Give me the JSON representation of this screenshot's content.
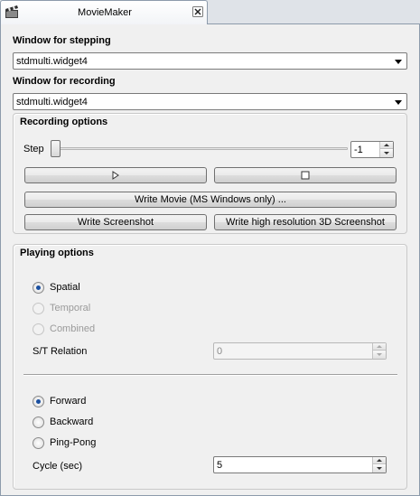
{
  "tab": {
    "title": "MovieMaker",
    "icon": "film-clapper-icon",
    "close_icon": "close-icon"
  },
  "stepping": {
    "label": "Window for stepping",
    "value": "stdmulti.widget4"
  },
  "recording": {
    "label": "Window for recording",
    "value": "stdmulti.widget4"
  },
  "recording_options": {
    "title": "Recording options",
    "step_label": "Step",
    "step_value": "-1",
    "play_icon": "play-icon",
    "stop_icon": "stop-icon",
    "write_movie": "Write Movie (MS Windows only) ...",
    "write_screenshot": "Write Screenshot",
    "write_hires": "Write high resolution 3D Screenshot"
  },
  "playing_options": {
    "title": "Playing options",
    "mode_options": [
      {
        "label": "Spatial",
        "checked": true,
        "enabled": true
      },
      {
        "label": "Temporal",
        "checked": false,
        "enabled": false
      },
      {
        "label": "Combined",
        "checked": false,
        "enabled": false
      }
    ],
    "st_relation_label": "S/T Relation",
    "st_relation_value": "0",
    "direction_options": [
      {
        "label": "Forward",
        "checked": true
      },
      {
        "label": "Backward",
        "checked": false
      },
      {
        "label": "Ping-Pong",
        "checked": false
      }
    ],
    "cycle_label": "Cycle (sec)",
    "cycle_value": "5"
  }
}
